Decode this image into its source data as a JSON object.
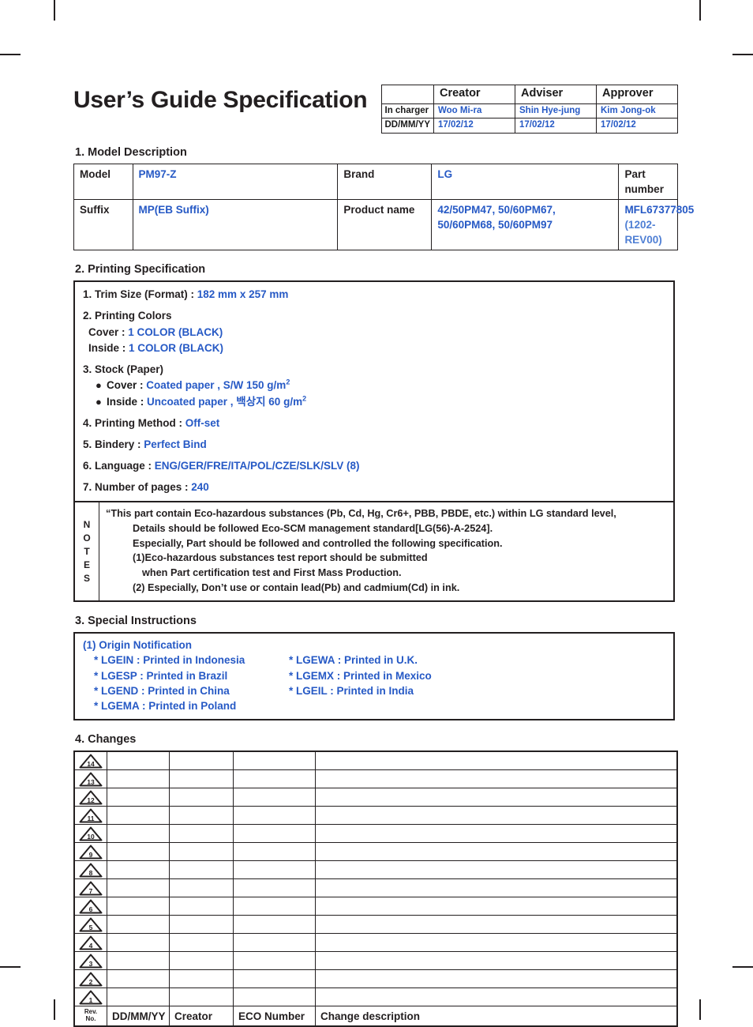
{
  "document": {
    "title": "User’s Guide Specification"
  },
  "approval": {
    "headers": [
      "",
      "Creator",
      "Adviser",
      "Approver"
    ],
    "rows": [
      {
        "label": "In charger",
        "values": [
          "Woo Mi-ra",
          "Shin Hye-jung",
          "Kim Jong-ok"
        ]
      },
      {
        "label": "DD/MM/YY",
        "values": [
          "17/02/12",
          "17/02/12",
          "17/02/12"
        ]
      }
    ]
  },
  "sections": {
    "model_description": {
      "heading": "1. Model Description",
      "labels": {
        "model": "Model",
        "suffix": "Suffix",
        "brand": "Brand",
        "product_name": "Product name",
        "part_number": "Part number"
      },
      "values": {
        "model": "PM97-Z",
        "suffix": "MP(EB Suffix)",
        "brand": "LG",
        "product_name_line1": "42/50PM47, 50/60PM67,",
        "product_name_line2": "50/60PM68, 50/60PM97",
        "part_number": "MFL67377805",
        "part_number_rev": "(1202-REV00)"
      }
    },
    "printing_specification": {
      "heading": "2. Printing Specification",
      "items": {
        "trim_size_label": "1. Trim Size (Format) : ",
        "trim_size_value": "182 mm x 257 mm",
        "printing_colors_label": "2. Printing Colors",
        "cover_color_label": "Cover : ",
        "cover_color_value": "1 COLOR (BLACK)",
        "inside_color_label": "Inside : ",
        "inside_color_value": "1 COLOR (BLACK)",
        "stock_label": "3. Stock (Paper)",
        "stock_cover_label": "Cover : ",
        "stock_cover_value": "Coated paper , S/W 150 g/m",
        "stock_cover_sup": "2",
        "stock_inside_label": "Inside : ",
        "stock_inside_value": "Uncoated paper , 백상지 60 g/m",
        "stock_inside_sup": "2",
        "printing_method_label": "4. Printing Method : ",
        "printing_method_value": "Off-set",
        "bindery_label": "5. Bindery  : ",
        "bindery_value": "Perfect Bind",
        "language_label": "6. Language : ",
        "language_value": "ENG/GER/FRE/ITA/POL/CZE/SLK/SLV (8)",
        "pages_label": "7. Number of pages : ",
        "pages_value": "240"
      },
      "notes": {
        "label_letters": [
          "N",
          "O",
          "T",
          "E",
          "S"
        ],
        "lines": [
          "“This part contain Eco-hazardous substances (Pb, Cd, Hg, Cr6+, PBB, PBDE, etc.) within LG standard level,",
          "Details should be followed Eco-SCM management standard[LG(56)-A-2524].",
          "Especially, Part should be followed and controlled the following specification.",
          "(1)Eco-hazardous substances test report should be submitted",
          "when  Part certification test and First Mass Production.",
          "(2) Especially, Don’t use or contain lead(Pb) and cadmium(Cd) in ink."
        ]
      }
    },
    "special_instructions": {
      "heading": "3. Special Instructions",
      "origin_title": "(1) Origin Notification",
      "origins": [
        {
          "left": "* LGEIN : Printed in Indonesia",
          "right": "* LGEWA : Printed in U.K."
        },
        {
          "left": "* LGESP : Printed in Brazil",
          "right": "* LGEMX : Printed in Mexico"
        },
        {
          "left": "* LGEND : Printed in China",
          "right": "* LGEIL : Printed in India"
        },
        {
          "left": "* LGEMA : Printed in Poland",
          "right": ""
        }
      ]
    },
    "changes": {
      "heading": "4. Changes",
      "revision_numbers": [
        "14",
        "13",
        "12",
        "11",
        "10",
        "9",
        "8",
        "7",
        "6",
        "5",
        "4",
        "3",
        "2",
        "1"
      ],
      "footer": {
        "rev_no_line1": "Rev.",
        "rev_no_line2": "No.",
        "date": "DD/MM/YY",
        "creator": "Creator",
        "eco_number": "ECO Number",
        "change_description": "Change description"
      }
    }
  },
  "colors": {
    "blue": "#2659c5",
    "blue_light": "#4f7fd4",
    "ink": "#231f20"
  }
}
